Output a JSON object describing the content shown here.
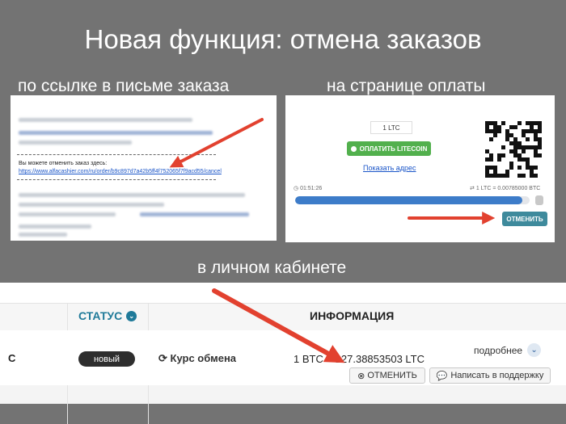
{
  "title": "Новая функция: отмена заказов",
  "labels": {
    "email": "по ссылке в письме заказа",
    "payment": "на странице оплаты",
    "cabinet": "в личном кабинете"
  },
  "email": {
    "cancel_label": "Вы можете отменить заказ здесь:",
    "cancel_link": "https://www.alfacashier.com/ru/order/b9c897d7a42b5ff4f752065f7f9acd55/cancel"
  },
  "payment": {
    "amount": "1 LTC",
    "pay_button": "ОПЛАТИТЬ LITECOIN",
    "show_address": "Показать адрес",
    "timer": "01:51:26",
    "rate": "1 LTC = 0.00785000 BTC",
    "cancel_button": "ОТМЕНИТЬ",
    "progress": 0.97
  },
  "cabinet": {
    "status_header": "СТАТУС",
    "info_header": "ИНФОРМАЦИЯ",
    "row_left_fragment": "С",
    "status_badge": "новый",
    "rate_label": "Курс обмена",
    "rate_value": "1 BTC = 127.38853503 LTC",
    "details": "подробнее",
    "cancel_button": "ОТМЕНИТЬ",
    "support_button": "Написать в поддержку"
  },
  "colors": {
    "background": "#737373",
    "arrow": "#e2412f",
    "teal": "#3e8a9c",
    "green": "#52b04d",
    "progress": "#3d7cc9",
    "status_header": "#1f7a99"
  }
}
